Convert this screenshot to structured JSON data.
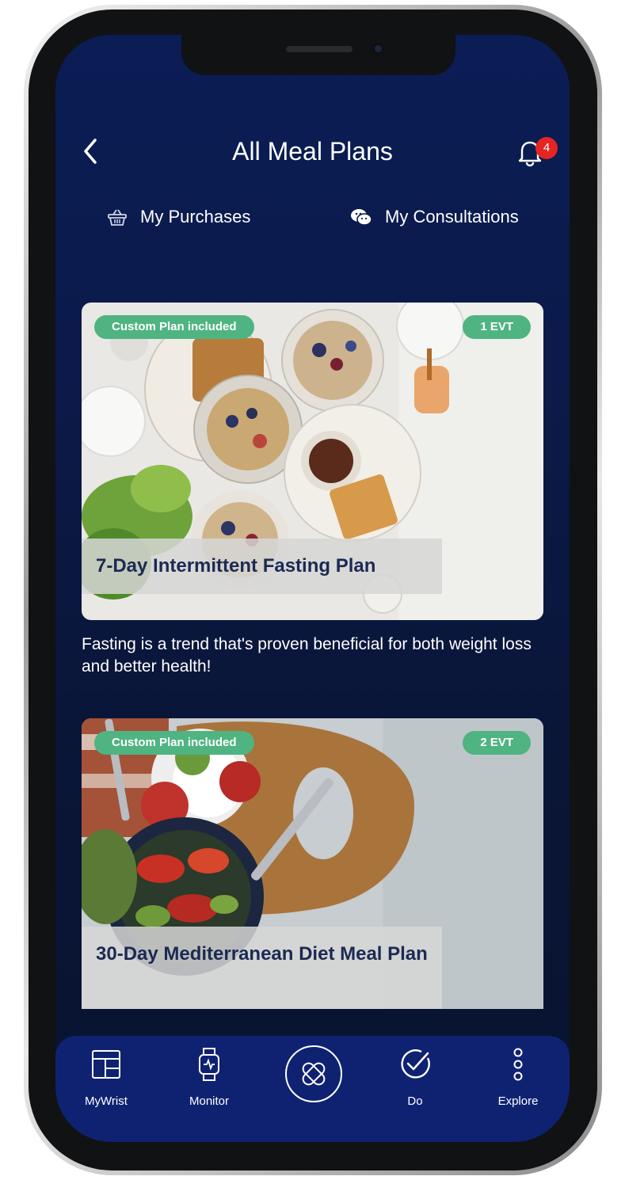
{
  "header": {
    "title": "All Meal Plans",
    "notification_count": "4"
  },
  "tabs": [
    {
      "label": "My Purchases",
      "icon": "basket-icon"
    },
    {
      "label": "My Consultations",
      "icon": "chat-bubbles-icon"
    }
  ],
  "plans": [
    {
      "badge": "Custom Plan included",
      "price": "1 EVT",
      "title": "7-Day Intermittent Fasting Plan",
      "description": "Fasting is a trend that's proven beneficial for both weight loss and better health!"
    },
    {
      "badge": "Custom Plan included",
      "price": "2 EVT",
      "title": "30-Day Mediterranean Diet Meal Plan"
    }
  ],
  "bottom_nav": [
    {
      "label": "MyWrist",
      "icon": "dashboard-icon"
    },
    {
      "label": "Monitor",
      "icon": "watch-icon"
    },
    {
      "label": "",
      "icon": "app-logo-icon"
    },
    {
      "label": "Do",
      "icon": "check-circle-icon"
    },
    {
      "label": "Explore",
      "icon": "more-vertical-icon"
    }
  ],
  "colors": {
    "background_top": "#0b1d55",
    "background_bottom": "#09132f",
    "pill_green": "#4fb482",
    "badge_red": "#e52424",
    "nav_blue": "#0f2272"
  }
}
